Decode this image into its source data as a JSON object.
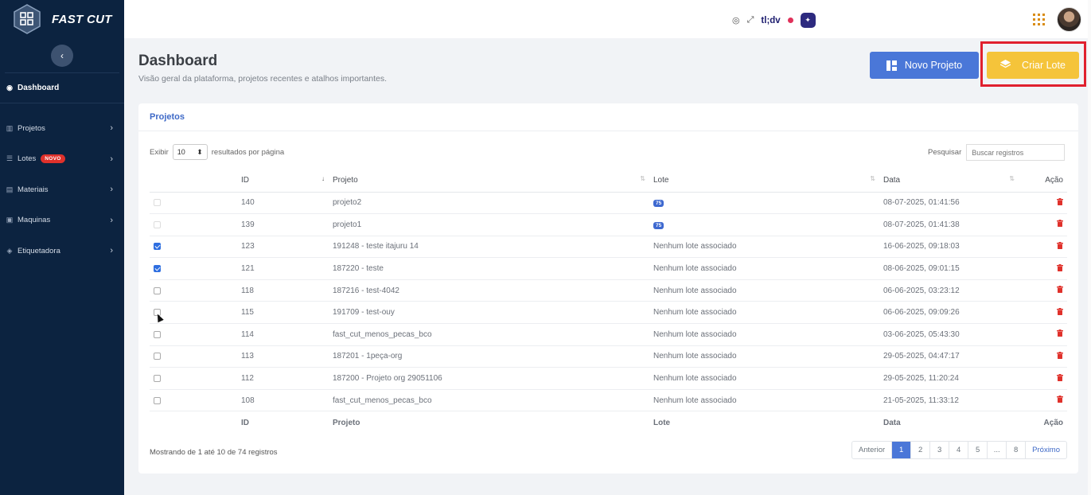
{
  "brand": {
    "name": "FAST CUT"
  },
  "sidebar": {
    "dashboard": "Dashboard",
    "items": [
      {
        "label": "Projetos",
        "icon": "columns-icon"
      },
      {
        "label": "Lotes",
        "icon": "list-icon",
        "badge": "NOVO"
      },
      {
        "label": "Materiais",
        "icon": "box-icon"
      },
      {
        "label": "Maquinas",
        "icon": "machine-icon"
      },
      {
        "label": "Etiquetadora",
        "icon": "tag-icon"
      }
    ]
  },
  "topbar": {
    "tldv": "tl;dv"
  },
  "header": {
    "title": "Dashboard",
    "subtitle": "Visão geral da plataforma, projetos recentes e atalhos importantes.",
    "novo_projeto": "Novo Projeto",
    "criar_lote": "Criar Lote"
  },
  "card": {
    "title": "Projetos",
    "length_prefix": "Exibir",
    "length_value": "10",
    "length_suffix": "resultados por página",
    "search_label": "Pesquisar",
    "search_placeholder": "Buscar registros"
  },
  "table": {
    "columns": [
      "ID",
      "Projeto",
      "Lote",
      "Data",
      "Ação"
    ],
    "rows": [
      {
        "checked": false,
        "disabled": true,
        "id": "140",
        "projeto": "projeto2",
        "lote": "75",
        "lote_badge": true,
        "data": "08-07-2025, 01:41:56"
      },
      {
        "checked": false,
        "disabled": true,
        "id": "139",
        "projeto": "projeto1",
        "lote": "75",
        "lote_badge": true,
        "data": "08-07-2025, 01:41:38"
      },
      {
        "checked": true,
        "disabled": false,
        "id": "123",
        "projeto": "191248 - teste itajuru 14",
        "lote": "Nenhum lote associado",
        "lote_badge": false,
        "data": "16-06-2025, 09:18:03"
      },
      {
        "checked": true,
        "disabled": false,
        "id": "121",
        "projeto": "187220 - teste",
        "lote": "Nenhum lote associado",
        "lote_badge": false,
        "data": "08-06-2025, 09:01:15"
      },
      {
        "checked": false,
        "disabled": false,
        "id": "118",
        "projeto": "187216 - test-4042",
        "lote": "Nenhum lote associado",
        "lote_badge": false,
        "data": "06-06-2025, 03:23:12"
      },
      {
        "checked": false,
        "disabled": false,
        "id": "115",
        "projeto": "191709 - test-ouy",
        "lote": "Nenhum lote associado",
        "lote_badge": false,
        "data": "06-06-2025, 09:09:26"
      },
      {
        "checked": false,
        "disabled": false,
        "id": "114",
        "projeto": "fast_cut_menos_pecas_bco",
        "lote": "Nenhum lote associado",
        "lote_badge": false,
        "data": "03-06-2025, 05:43:30"
      },
      {
        "checked": false,
        "disabled": false,
        "id": "113",
        "projeto": "187201 - 1peça-org",
        "lote": "Nenhum lote associado",
        "lote_badge": false,
        "data": "29-05-2025, 04:47:17"
      },
      {
        "checked": false,
        "disabled": false,
        "id": "112",
        "projeto": "187200 - Projeto org 29051106",
        "lote": "Nenhum lote associado",
        "lote_badge": false,
        "data": "29-05-2025, 11:20:24"
      },
      {
        "checked": false,
        "disabled": false,
        "id": "108",
        "projeto": "fast_cut_menos_pecas_bco",
        "lote": "Nenhum lote associado",
        "lote_badge": false,
        "data": "21-05-2025, 11:33:12"
      }
    ]
  },
  "footer": {
    "info": "Mostrando de 1 até 10 de 74 registros",
    "prev": "Anterior",
    "pages": [
      "1",
      "2",
      "3",
      "4",
      "5",
      "...",
      "8"
    ],
    "active_page": "1",
    "next": "Próximo"
  },
  "colors": {
    "sidebar": "#0c2340",
    "primary": "#4a77d8",
    "warning": "#f5c43a",
    "danger": "#e0312b",
    "highlight": "#e0202e"
  }
}
